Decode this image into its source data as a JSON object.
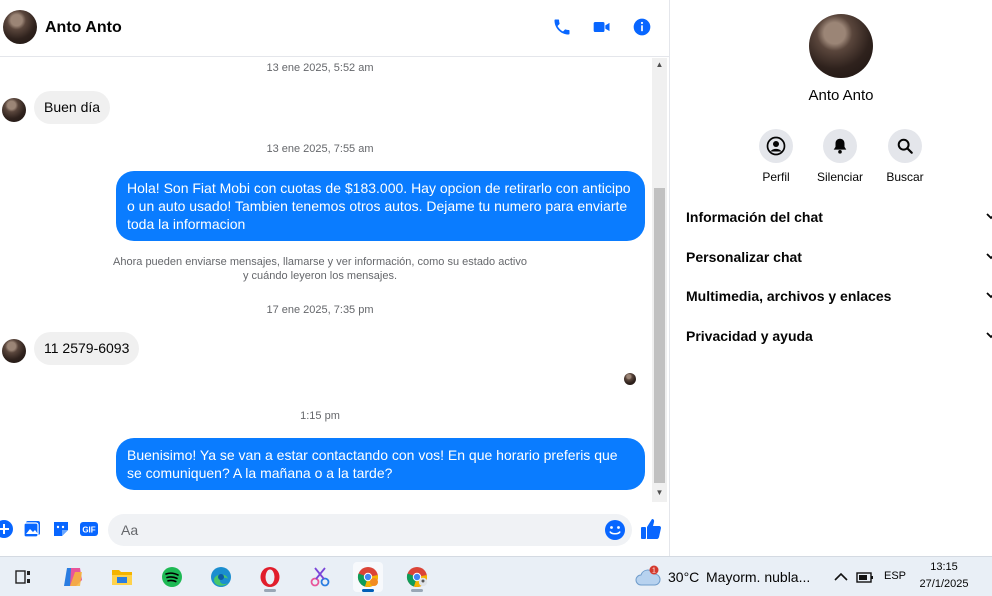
{
  "header": {
    "contact_name": "Anto Anto"
  },
  "messages": {
    "ts1": "13 ene 2025, 5:52 am",
    "in1": "Buen día",
    "ts2": "13 ene 2025, 7:55 am",
    "out1": "Hola! Son Fiat Mobi con cuotas de $183.000. Hay opcion de retirarlo con anticipo o un auto usado! Tambien tenemos otros autos. Dejame tu numero para enviarte toda la informacion",
    "system_line1": "Ahora pueden enviarse mensajes, llamarse y ver información, como su estado activo",
    "system_line2": "y cuándo leyeron los mensajes.",
    "ts3": "17 ene 2025, 7:35 pm",
    "in2": "11 2579-6093",
    "ts4": "1:15 pm",
    "out2": "Buenisimo! Ya se van a estar contactando con vos! En que horario preferis que se comuniquen? A la mañana o a la tarde?"
  },
  "composer": {
    "placeholder": "Aa"
  },
  "info": {
    "name": "Anto Anto",
    "actions": {
      "profile": "Perfil",
      "mute": "Silenciar",
      "search": "Buscar"
    },
    "sections": {
      "chat_info": "Información del chat",
      "customize": "Personalizar chat",
      "media": "Multimedia, archivos y enlaces",
      "privacy": "Privacidad y ayuda"
    }
  },
  "taskbar": {
    "weather_badge": "1",
    "temperature": "30°C",
    "weather": "Mayorm. nubla...",
    "language": "ESP",
    "time": "13:15",
    "date": "27/1/2025"
  },
  "colors": {
    "accent": "#0a7cff",
    "incoming_bubble": "#f0f0f0",
    "messenger_blue": "#0866ff"
  }
}
